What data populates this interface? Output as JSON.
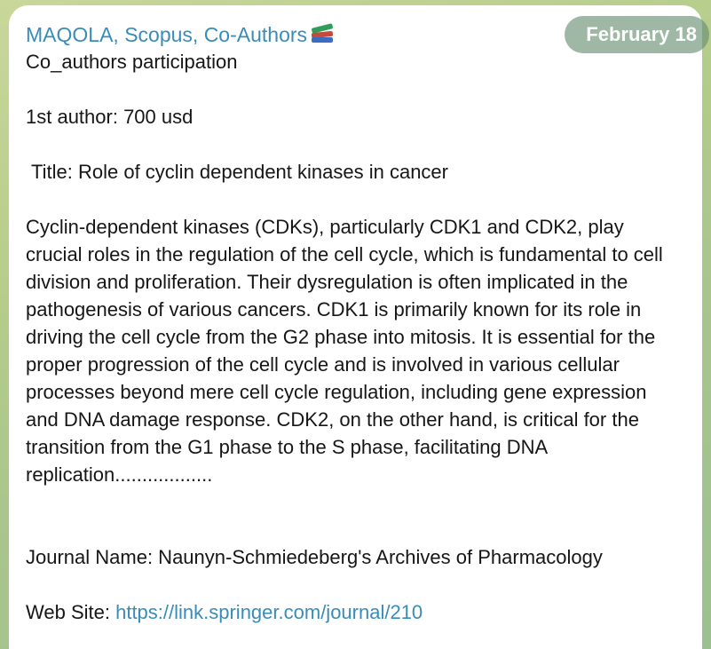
{
  "message": {
    "sender": "MAQOLA, Scopus, Co-Authors",
    "sender_emoji": "books-icon",
    "date": "February 18",
    "line1": "Co_authors participation",
    "line2": "1st author: 700 usd",
    "line3": "Title: Role of cyclin dependent kinases in cancer",
    "abstract": "Cyclin-dependent kinases (CDKs), particularly CDK1 and CDK2, play crucial roles in the regulation of the cell cycle, which is fundamental to cell division and proliferation. Their dysregulation is often implicated in the pathogenesis of various cancers. CDK1 is primarily known for its role in driving the cell cycle from the G2 phase into mitosis. It is essential for the proper progression of the cell cycle and is involved in various cellular processes beyond mere cell cycle regulation, including gene expression and DNA damage response. CDK2, on the other hand, is critical for the transition from the G1 phase to the S phase, facilitating DNA replication..................",
    "journal": "Journal Name: Naunyn-Schmiedeberg's Archives of Pharmacology",
    "website_label": "Web Site: ",
    "website_url": "https://link.springer.com/journal/210"
  },
  "colors": {
    "link": "#3a8cb8",
    "bubble": "#ffffff",
    "badge": "#7fa186"
  }
}
